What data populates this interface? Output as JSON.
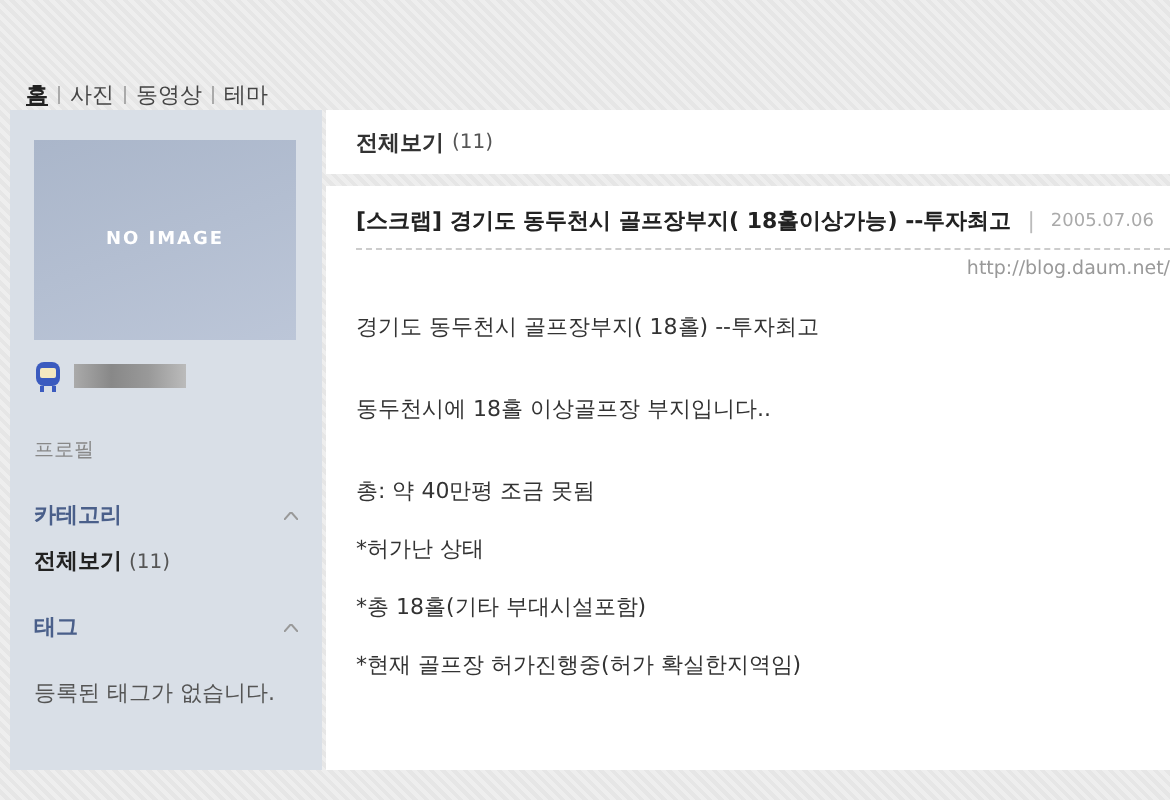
{
  "nav": [
    {
      "label": "홈",
      "selected": true
    },
    {
      "label": "사진",
      "selected": false
    },
    {
      "label": "동영상",
      "selected": false
    },
    {
      "label": "테마",
      "selected": false
    }
  ],
  "sidebar": {
    "image_label": "NO IMAGE",
    "profile_link": "프로필",
    "sections": [
      {
        "title": "카테고리",
        "items": [
          {
            "label": "전체보기",
            "count": "(11)"
          }
        ]
      },
      {
        "title": "태그",
        "empty_text": "등록된 태그가 없습니다."
      }
    ]
  },
  "main": {
    "header": {
      "title": "전체보기",
      "count": "(11)"
    },
    "post": {
      "title": "[스크랩] 경기도 동두천시 골프장부지( 18홀이상가능) --투자최고",
      "date": "2005.07.06",
      "source_url": "http://blog.daum.net/",
      "title_separator": "|",
      "paragraphs": [
        [
          "경기도 동두천시 골프장부지( 18홀) --투자최고"
        ],
        [
          "동두천시에 18홀 이상골프장 부지입니다.."
        ],
        [
          "총: 약 40만평 조금 못됨",
          "*허가난 상태",
          "*총 18홀(기타 부대시설포함)",
          "*현재 골프장 허가진행중(허가 확실한지역임)"
        ]
      ]
    }
  }
}
